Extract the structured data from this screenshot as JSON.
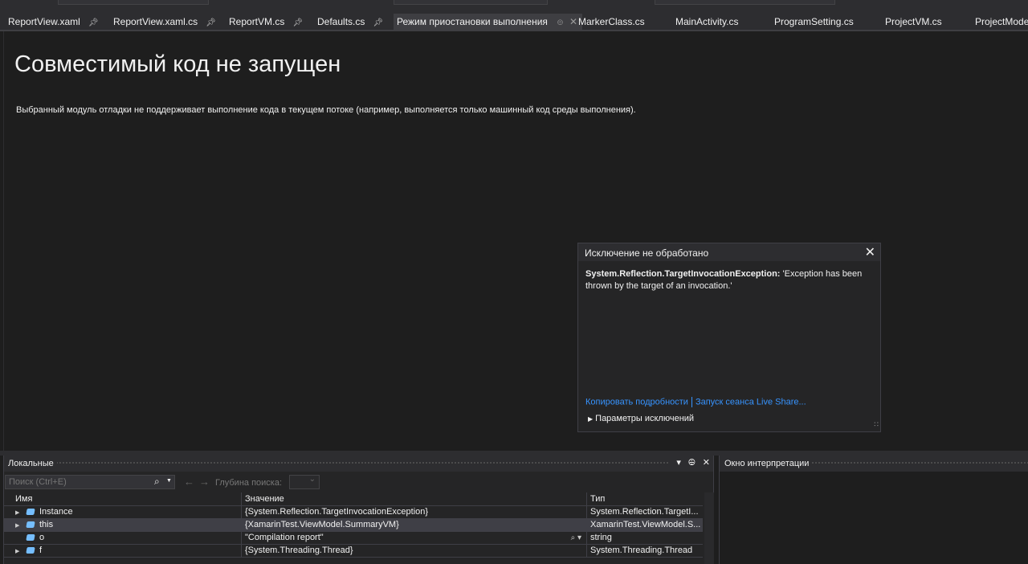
{
  "tabs": [
    {
      "label": "ReportView.xaml",
      "pinned": true
    },
    {
      "label": "ReportView.xaml.cs",
      "pinned": true
    },
    {
      "label": "ReportVM.cs",
      "pinned": true
    },
    {
      "label": "Defaults.cs",
      "pinned": true
    },
    {
      "label": "Режим приостановки выполнения",
      "pinned": true,
      "active": true
    },
    {
      "label": "MarkerClass.cs"
    },
    {
      "label": "MainActivity.cs"
    },
    {
      "label": "ProgramSetting.cs"
    },
    {
      "label": "ProjectVM.cs"
    },
    {
      "label": "ProjectModel.cs"
    }
  ],
  "main": {
    "title": "Совместимый код не запущен",
    "description": "Выбранный модуль отладки не поддерживает выполнение кода в текущем потоке (например, выполняется только машинный код среды выполнения)."
  },
  "exception": {
    "title": "Исключение не обработано",
    "type": "System.Reflection.TargetInvocationException:",
    "message": " 'Exception has been thrown by the target of an invocation.'",
    "copy_details": "Копировать подробности",
    "live_share": "Запуск сеанса Live Share...",
    "settings": "Параметры исключений"
  },
  "locals": {
    "title": "Локальные",
    "search_placeholder": "Поиск (Ctrl+E)",
    "depth_label": "Глубина поиска:",
    "columns": [
      "Имя",
      "Значение",
      "Тип"
    ],
    "rows": [
      {
        "name": "Instance",
        "value": "{System.Reflection.TargetInvocationException}",
        "type": "System.Reflection.TargetI...",
        "expandable": true
      },
      {
        "name": "this",
        "value": "{XamarinTest.ViewModel.SummaryVM}",
        "type": "XamarinTest.ViewModel.S...",
        "expandable": true
      },
      {
        "name": "o",
        "value": "\"Compilation report\"",
        "type": "string",
        "expandable": false
      },
      {
        "name": "f",
        "value": "{System.Threading.Thread}",
        "type": "System.Threading.Thread",
        "expandable": true
      }
    ]
  },
  "immediate": {
    "title": "Окно интерпретации"
  },
  "colors": {
    "background": "#1e1e1e",
    "panel": "#252526",
    "link": "#3794ff",
    "field_icon": "#75beff"
  }
}
